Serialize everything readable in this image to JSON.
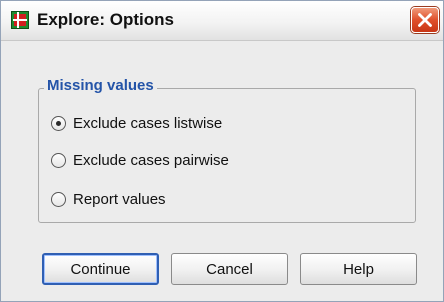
{
  "window": {
    "title": "Explore: Options",
    "icons": {
      "app": "spss-app-icon",
      "close": "close-icon"
    }
  },
  "missing_values": {
    "legend": "Missing values",
    "options": [
      {
        "label": "Exclude cases listwise",
        "selected": true
      },
      {
        "label": "Exclude cases pairwise",
        "selected": false
      },
      {
        "label": "Report values",
        "selected": false
      }
    ]
  },
  "buttons": {
    "continue": "Continue",
    "cancel": "Cancel",
    "help": "Help"
  },
  "colors": {
    "legend_text": "#2454a8",
    "close_button": "#e04f2a",
    "default_button_border": "#2f5fb3"
  }
}
